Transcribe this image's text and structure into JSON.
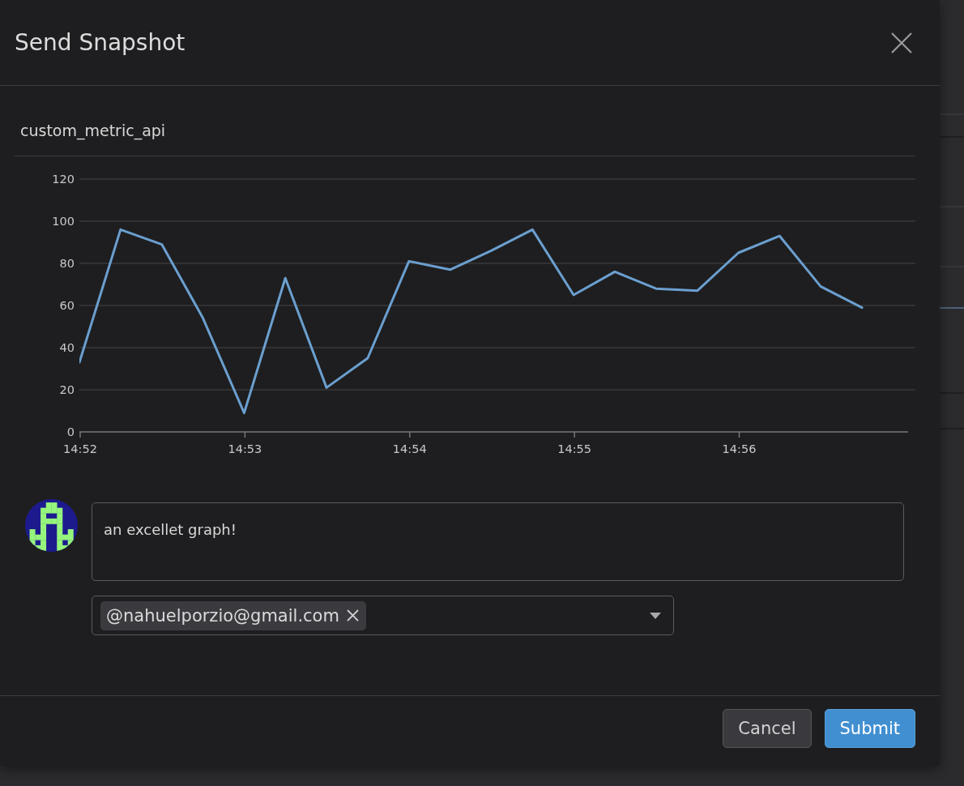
{
  "dialog": {
    "title": "Send Snapshot"
  },
  "chart": {
    "chart_data": {
      "type": "line",
      "title": "custom_metric_api",
      "grid": true,
      "categories": [
        "14:52",
        null,
        null,
        null,
        "14:53",
        null,
        null,
        null,
        "14:54",
        null,
        null,
        null,
        "14:55",
        null,
        null,
        null,
        "14:56",
        null,
        null,
        null
      ],
      "series": [
        {
          "color": "#6b9fcf",
          "values": [
            33,
            96,
            89,
            54,
            9,
            73,
            21,
            35,
            81,
            77,
            86,
            96,
            65,
            76,
            68,
            67,
            85,
            93,
            69,
            59
          ]
        }
      ],
      "ylim": [
        0,
        120
      ],
      "yticks": [
        0,
        20,
        40,
        60,
        80,
        100,
        120
      ]
    }
  },
  "comment": {
    "value": "an excellet graph!"
  },
  "recipients": [
    {
      "label": "@nahuelporzio@gmail.com"
    }
  ],
  "buttons": [
    {
      "label": "Cancel",
      "kind": "secondary"
    },
    {
      "label": "Submit",
      "kind": "primary"
    }
  ]
}
